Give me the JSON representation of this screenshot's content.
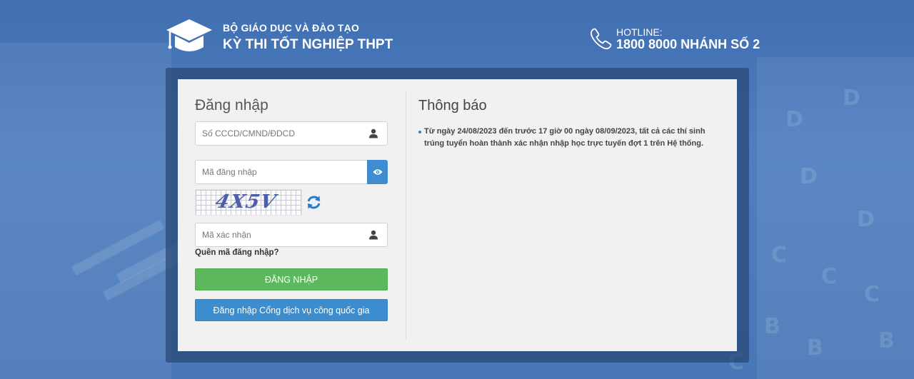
{
  "header": {
    "org_name": "BỘ GIÁO DỤC VÀ ĐÀO TẠO",
    "exam_name": "KỲ THI TỐT NGHIỆP THPT",
    "hotline_label": "HOTLINE:",
    "hotline_number": "1800 8000 NHÁNH SỐ 2"
  },
  "login": {
    "title": "Đăng nhập",
    "id_placeholder": "Số CCCD/CMND/ĐDCD",
    "password_placeholder": "Mã đăng nhập",
    "captcha_text": "4X5V",
    "captcha_input_placeholder": "Mã xác nhận",
    "forgot_link": "Quên mã đăng nhập?",
    "login_button": "ĐĂNG NHẬP",
    "national_portal_button": "Đăng nhập Cổng dịch vụ công quốc gia"
  },
  "notice": {
    "title": "Thông báo",
    "items": [
      {
        "line1": "Từ ngày 24/08/2023 đến trước 17 giờ 00 ngày 08/09/2023, tất cả các thí sinh",
        "line2": "trúng tuyển hoàn thành xác nhận nhập học trực tuyến đợt 1 trên Hệ thống."
      }
    ]
  },
  "icons": {
    "logo": "graduation-cap-icon",
    "phone": "phone-icon",
    "user": "user-icon",
    "eye": "eye-icon",
    "refresh": "refresh-icon"
  },
  "colors": {
    "background": "#4a7abb",
    "login_button": "#5cb85c",
    "national_button": "#3c8dd0",
    "eye_button": "#3f8dd0"
  }
}
